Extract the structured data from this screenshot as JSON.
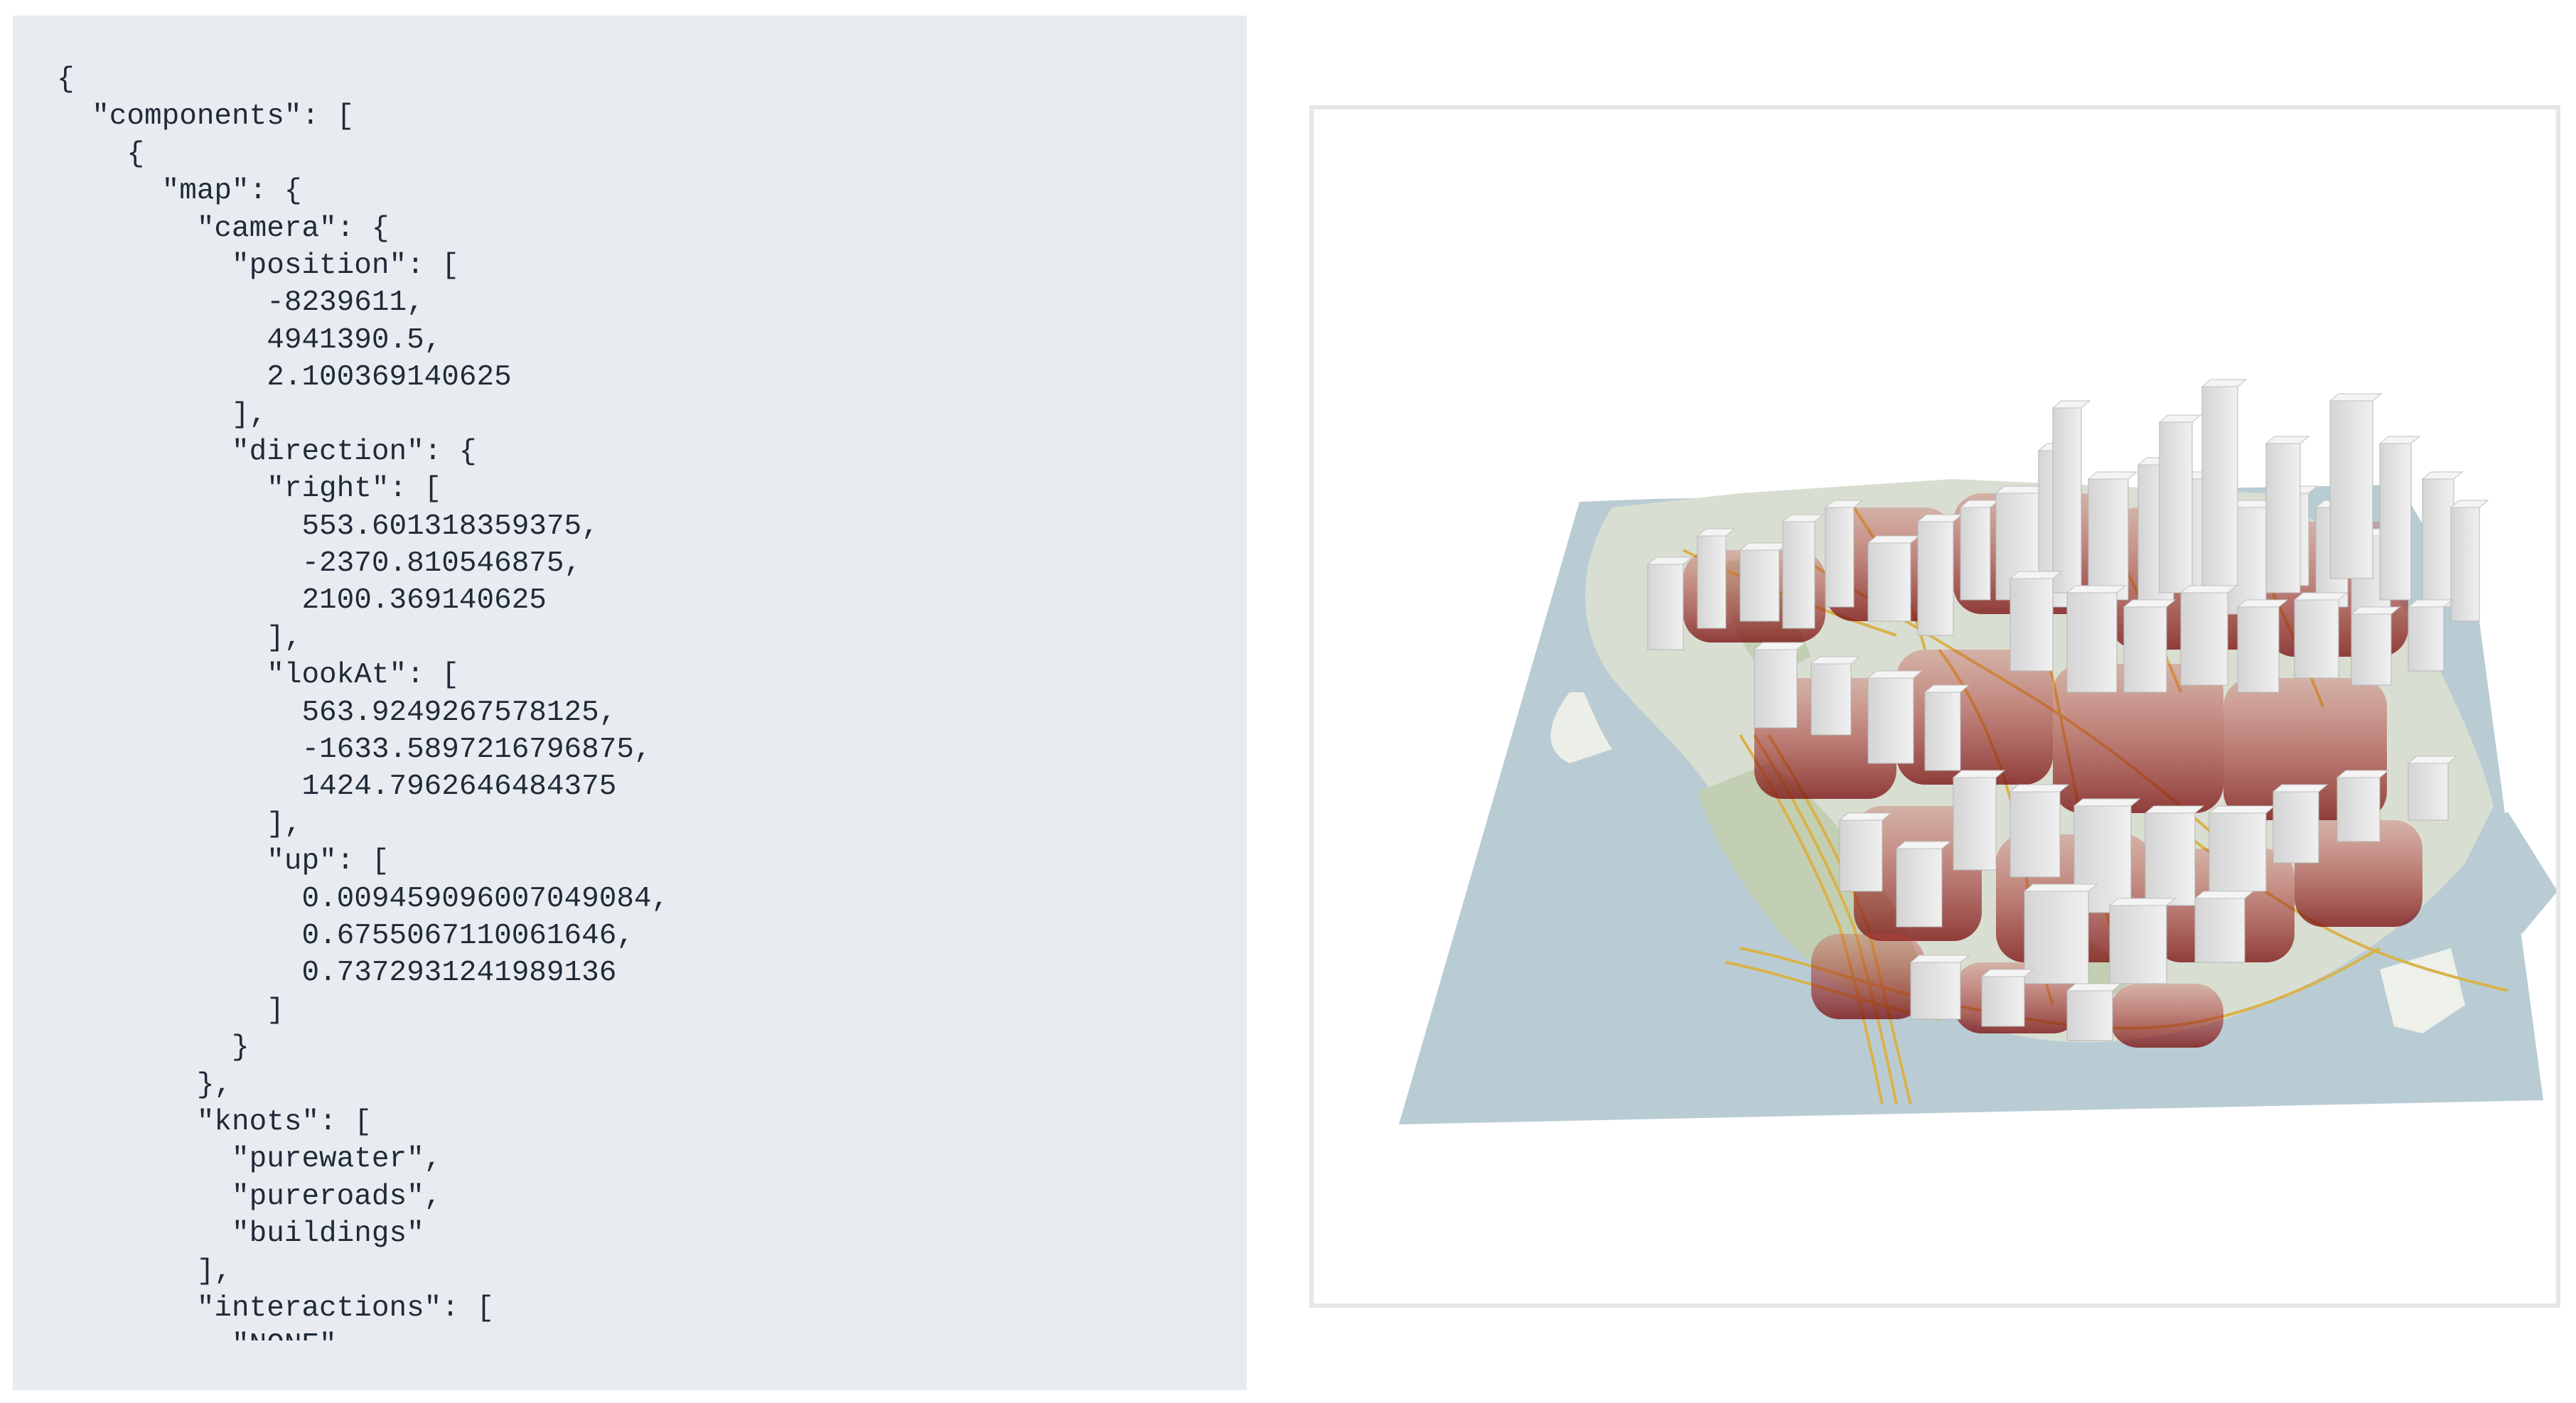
{
  "editor": {
    "lines": [
      "{",
      "  \"components\": [",
      "    {",
      "      \"map\": {",
      "        \"camera\": {",
      "          \"position\": [",
      "            -8239611,",
      "            4941390.5,",
      "            2.100369140625",
      "          ],",
      "          \"direction\": {",
      "            \"right\": [",
      "              553.601318359375,",
      "              -2370.810546875,",
      "              2100.369140625",
      "            ],",
      "            \"lookAt\": [",
      "              563.9249267578125,",
      "              -1633.5897216796875,",
      "              1424.7962646484375",
      "            ],",
      "            \"up\": [",
      "              0.009459096007049084,",
      "              0.6755067110061646,",
      "              0.7372931241989136",
      "            ]",
      "          }",
      "        },",
      "        \"knots\": [",
      "          \"purewater\",",
      "          \"pureroads\",",
      "          \"buildings\"",
      "        ],",
      "        \"interactions\": [",
      "          \"NONE\""
    ]
  },
  "map_view": {
    "colors": {
      "water": "#b9ccd4",
      "land": "#c9d3c0",
      "park": "#c2cfb3",
      "roads": "#d9b24a",
      "building_face": "#e9e9e9",
      "building_shade": "#c9c9c9",
      "shadow_dark": "#7a0f0f",
      "shadow_light": "#c6423a"
    }
  }
}
